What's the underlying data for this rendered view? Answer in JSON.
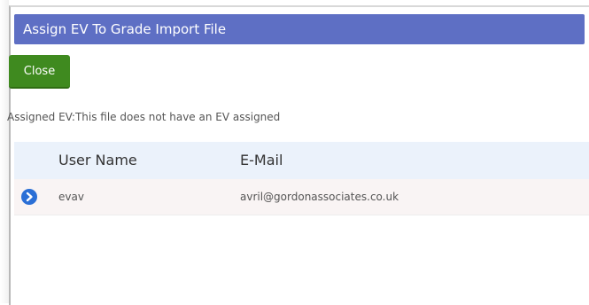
{
  "dialog": {
    "title": "Assign EV To Grade Import File"
  },
  "toolbar": {
    "close_label": "Close"
  },
  "status": {
    "assigned_ev_text": "Assigned EV:This file does not have an EV assigned"
  },
  "table": {
    "columns": [
      "User Name",
      "E-Mail"
    ],
    "rows": [
      {
        "user_name": "evav",
        "email": "avril@gordonassociates.co.uk",
        "action_icon": "arrow-right-circle-icon"
      }
    ]
  },
  "colors": {
    "title_bar": "#5e6fc4",
    "close_button": "#3f8a1f",
    "header_bg": "#ebf2fb",
    "row_bg": "#f9f4f4",
    "row_icon": "#2a6fd6"
  }
}
